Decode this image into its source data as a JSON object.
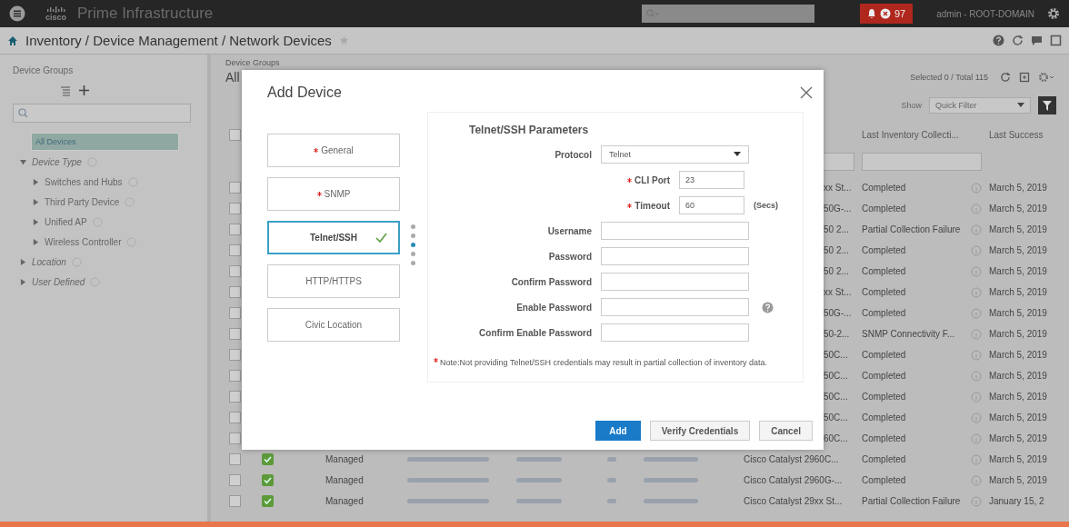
{
  "topbar": {
    "logo": "cisco",
    "product": "Prime Infrastructure",
    "alarm_count": "97",
    "user": "admin - ROOT-DOMAIN"
  },
  "breadcrumb": "Inventory / Device Management / Network Devices",
  "sidebar": {
    "title": "Device Groups",
    "tree": [
      {
        "label": "All Devices",
        "selected": true
      },
      {
        "label": "Device Type",
        "selected": false,
        "expanded": true,
        "children": [
          {
            "label": "Switches and Hubs",
            "selected": false,
            "expanded": false
          },
          {
            "label": "Third Party Device",
            "selected": false,
            "expanded": false
          },
          {
            "label": "Unified AP",
            "selected": false,
            "expanded": false
          },
          {
            "label": "Wireless Controller",
            "selected": false,
            "expanded": false
          }
        ]
      },
      {
        "label": "Location",
        "selected": false,
        "expanded": false
      },
      {
        "label": "User Defined",
        "selected": false,
        "expanded": false
      }
    ]
  },
  "main": {
    "group_label": "Device Groups",
    "group_name": "All",
    "selection": "Selected 0 / Total 115",
    "show_label": "Show",
    "filter": "Quick Filter",
    "columns": [
      "Last Inventory Collecti...",
      "Last Success"
    ],
    "all_checked": false,
    "rows": [
      {
        "checked": false,
        "kind": "covered",
        "device_type": "xx St...",
        "collection": "Completed",
        "last_success": "March 5, 2019"
      },
      {
        "checked": false,
        "kind": "covered",
        "device_type": "50G-...",
        "collection": "Completed",
        "last_success": "March 5, 2019"
      },
      {
        "checked": false,
        "kind": "covered",
        "device_type": "50 2...",
        "collection": "Partial Collection Failure",
        "last_success": "March 5, 2019"
      },
      {
        "checked": false,
        "kind": "covered",
        "device_type": "50 2...",
        "collection": "Completed",
        "last_success": "March 5, 2019"
      },
      {
        "checked": false,
        "kind": "covered",
        "device_type": "50 2...",
        "collection": "Completed",
        "last_success": "March 5, 2019"
      },
      {
        "checked": false,
        "kind": "covered",
        "device_type": "xx St...",
        "collection": "Completed",
        "last_success": "March 5, 2019"
      },
      {
        "checked": false,
        "kind": "covered",
        "device_type": "50G-...",
        "collection": "Completed",
        "last_success": "March 5, 2019"
      },
      {
        "checked": false,
        "kind": "covered",
        "device_type": "50-2...",
        "collection": "SNMP Connectivity F...",
        "last_success": "March 5, 2019"
      },
      {
        "checked": false,
        "kind": "covered",
        "device_type": "50C...",
        "collection": "Completed",
        "last_success": "March 5, 2019"
      },
      {
        "checked": false,
        "kind": "covered",
        "device_type": "50C...",
        "collection": "Completed",
        "last_success": "March 5, 2019"
      },
      {
        "checked": false,
        "kind": "covered",
        "device_type": "50C...",
        "collection": "Completed",
        "last_success": "March 5, 2019"
      },
      {
        "checked": false,
        "kind": "covered",
        "device_type": "50C...",
        "collection": "Completed",
        "last_success": "March 5, 2019"
      },
      {
        "checked": false,
        "kind": "covered",
        "device_type": "60C...",
        "collection": "Completed",
        "last_success": "March 5, 2019"
      },
      {
        "checked": false,
        "kind": "full",
        "status": "Managed",
        "device_type": "Cisco Catalyst 2960C...",
        "collection": "Completed",
        "last_success": "March 5, 2019"
      },
      {
        "checked": false,
        "kind": "full",
        "status": "Managed",
        "device_type": "Cisco Catalyst 2960G-...",
        "collection": "Completed",
        "last_success": "March 5, 2019"
      },
      {
        "checked": false,
        "kind": "full",
        "status": "Managed",
        "device_type": "Cisco Catalyst 29xx St...",
        "collection": "Partial Collection Failure",
        "last_success": "January 15, 2"
      }
    ]
  },
  "dialog": {
    "title": "Add Device",
    "steps": [
      {
        "label": "General",
        "required": true,
        "selected": false,
        "done": false
      },
      {
        "label": "SNMP",
        "required": true,
        "selected": false,
        "done": false
      },
      {
        "label": "Telnet/SSH",
        "required": false,
        "selected": true,
        "done": true
      },
      {
        "label": "HTTP/HTTPS",
        "required": false,
        "selected": false,
        "done": false
      },
      {
        "label": "Civic Location",
        "required": false,
        "selected": false,
        "done": false
      }
    ],
    "section_title": "Telnet/SSH Parameters",
    "fields": [
      {
        "kind": "select",
        "label": "Protocol",
        "value": "Telnet",
        "required": false
      },
      {
        "kind": "short",
        "label": "CLI Port",
        "value": "23",
        "required": true
      },
      {
        "kind": "short",
        "label": "Timeout",
        "value": "60",
        "required": true,
        "unit": "(Secs)"
      },
      {
        "kind": "text",
        "label": "Username",
        "required": false
      },
      {
        "kind": "password",
        "label": "Password",
        "required": false
      },
      {
        "kind": "password",
        "label": "Confirm Password",
        "required": false
      },
      {
        "kind": "password",
        "label": "Enable Password",
        "required": false,
        "help": true
      },
      {
        "kind": "password",
        "label": "Confirm Enable Password",
        "required": false
      }
    ],
    "note": "Note:Not providing Telnet/SSH credentials may result in partial collection of inventory data.",
    "buttons": [
      {
        "label": "Add",
        "primary": true
      },
      {
        "label": "Verify Credentials",
        "primary": false
      },
      {
        "label": "Cancel",
        "primary": false
      }
    ]
  }
}
